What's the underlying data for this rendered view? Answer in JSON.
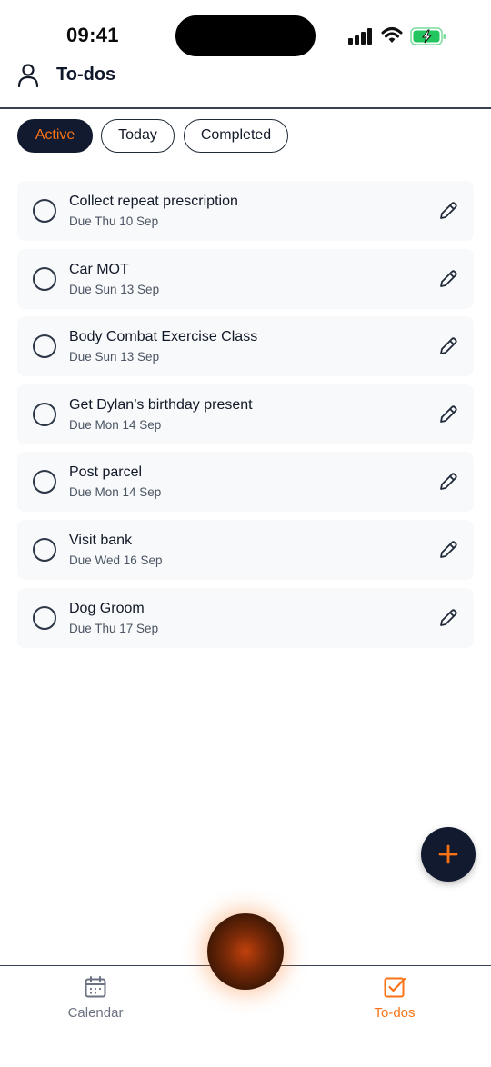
{
  "status_bar": {
    "time": "09:41"
  },
  "header": {
    "title": "To-dos",
    "profile_icon": "person-icon"
  },
  "filters": [
    {
      "label": "Active",
      "selected": true
    },
    {
      "label": "Today",
      "selected": false
    },
    {
      "label": "Completed",
      "selected": false
    }
  ],
  "todos": [
    {
      "title": "Collect repeat prescription",
      "due": "Due Thu 10 Sep",
      "done": false
    },
    {
      "title": "Car MOT",
      "due": "Due Sun 13 Sep",
      "done": false
    },
    {
      "title": "Body Combat Exercise Class",
      "due": "Due Sun 13 Sep",
      "done": false
    },
    {
      "title": "Get Dylan’s birthday present",
      "due": "Due Mon 14 Sep",
      "done": false
    },
    {
      "title": "Post parcel",
      "due": "Due Mon 14 Sep",
      "done": false
    },
    {
      "title": "Visit bank",
      "due": "Due Wed 16 Sep",
      "done": false
    },
    {
      "title": "Dog Groom",
      "due": "Due Thu 17 Sep",
      "done": false
    }
  ],
  "fab": {
    "icon": "plus-icon"
  },
  "bottom_nav": [
    {
      "label": "Calendar",
      "icon": "calendar-icon",
      "active": false
    },
    {
      "label": "To-dos",
      "icon": "checkbox-icon",
      "active": true
    }
  ],
  "colors": {
    "accent": "#f97316",
    "navy": "#111a2e",
    "card": "#f8f9fa"
  }
}
